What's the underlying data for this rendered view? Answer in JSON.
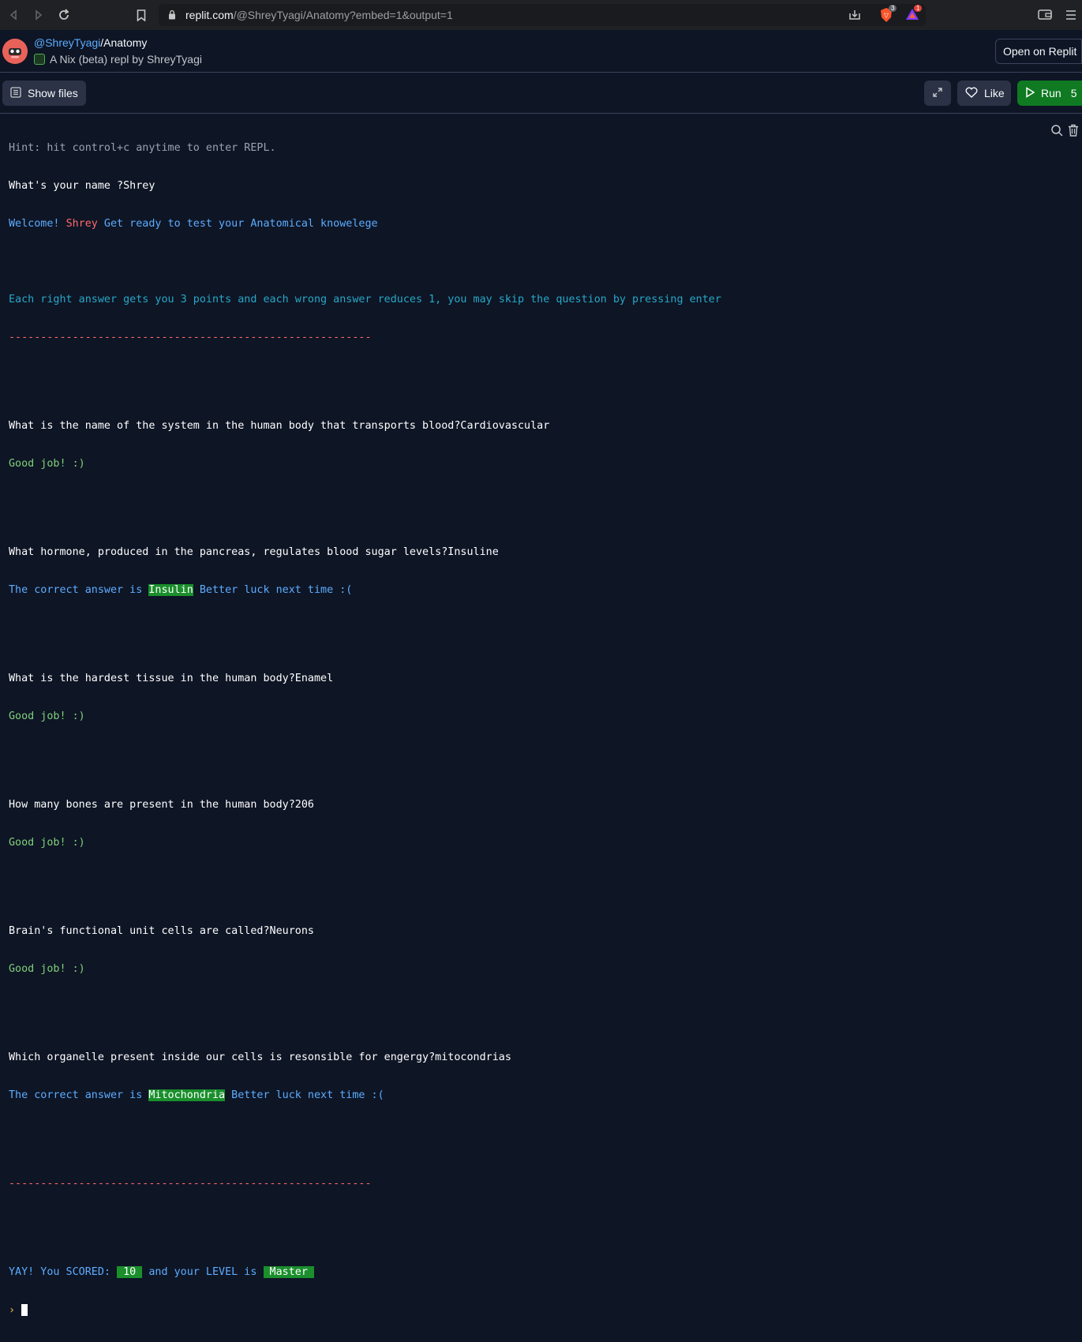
{
  "browser": {
    "url_host": "replit.com",
    "url_path": "/@ShreyTyagi/Anatomy?embed=1&output=1",
    "brave_badge": "3",
    "alert_badge": "1"
  },
  "header": {
    "user": "@ShreyTyagi",
    "separator": "/",
    "repl_name": "Anatomy",
    "subtitle": "A Nix (beta) repl by ShreyTyagi",
    "open_button": "Open on Replit"
  },
  "toolbar": {
    "show_files": "Show files",
    "like": "Like",
    "run": "Run",
    "run_count": "5"
  },
  "console": {
    "hint": "Hint: hit control+c anytime to enter REPL.",
    "name_prompt": "What's your name ?Shrey",
    "welcome_prefix": "Welcome! ",
    "welcome_name": "Shrey",
    "welcome_suffix": " Get ready to test your Anatomical knowelege",
    "rules": "Each right answer gets you 3 points and each wrong answer reduces 1, you may skip the question by pressing enter",
    "divider": "---------------------------------------------------------",
    "questions": [
      {
        "q": "What is the name of the system in the human body that transports blood?Cardiovascular",
        "result": "Good job! :)"
      },
      {
        "q": "What hormone, produced in the pancreas, regulates blood sugar levels?Insuline",
        "wrong_prefix": "The correct answer is ",
        "answer": "Insulin",
        "wrong_suffix": " Better luck next time :("
      },
      {
        "q": "What is the hardest tissue in the human body?Enamel",
        "result": "Good job! :)"
      },
      {
        "q": "How many bones are present in the human body?206",
        "result": "Good job! :)"
      },
      {
        "q": "Brain's functional unit cells are called?Neurons",
        "result": "Good job! :)"
      },
      {
        "q": "Which organelle present inside our cells is resonsible for engergy?mitocondrias",
        "wrong_prefix": "The correct answer is ",
        "answer": "Mitochondria",
        "wrong_suffix": " Better luck next time :("
      }
    ],
    "score_prefix": "YAY! You SCORED: ",
    "score": " 10 ",
    "level_prefix": " and your LEVEL is ",
    "level": " Master ",
    "prompt_symbol": "›"
  }
}
